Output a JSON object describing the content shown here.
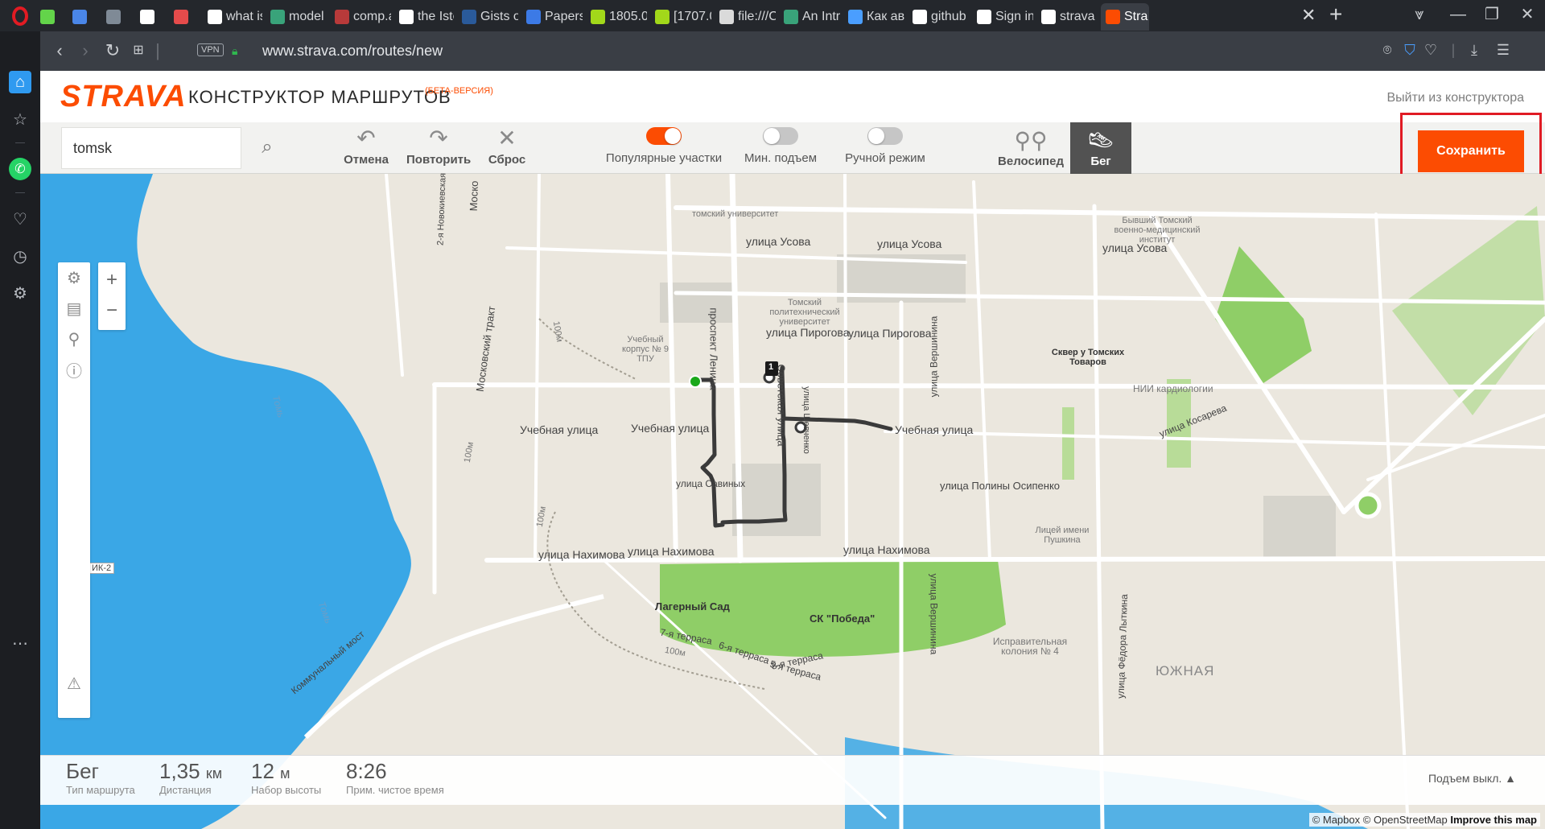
{
  "browser": {
    "tabs": [
      {
        "label": "",
        "color": "#63d44a"
      },
      {
        "label": "",
        "color": "#4a86e8"
      },
      {
        "label": "",
        "color": "#7f8a96"
      },
      {
        "label": "",
        "color": "#ffffff"
      },
      {
        "label": "",
        "color": "#e54b4b"
      },
      {
        "label": "what is",
        "color": "#ffffff"
      },
      {
        "label": "model",
        "color": "#39a37a"
      },
      {
        "label": "comp.a",
        "color": "#b83a3a"
      },
      {
        "label": "the Iste",
        "color": "#ffffff"
      },
      {
        "label": "Gists of",
        "color": "#2a5a9a"
      },
      {
        "label": "Papers",
        "color": "#3c7ae6"
      },
      {
        "label": "1805.0",
        "color": "#a2d81a"
      },
      {
        "label": "[1707.0",
        "color": "#a2d81a"
      },
      {
        "label": "file:///C",
        "color": "#dadada"
      },
      {
        "label": "An Intr",
        "color": "#39a37a"
      },
      {
        "label": "Как ав",
        "color": "#4a9eff"
      },
      {
        "label": "github",
        "color": "#ffffff"
      },
      {
        "label": "Sign in",
        "color": "#ffffff"
      },
      {
        "label": "strava",
        "color": "#ffffff"
      },
      {
        "label": "Stra",
        "color": "#fc4c02"
      }
    ],
    "url": "www.strava.com/routes/new",
    "vpn_label": "VPN"
  },
  "header": {
    "logo": "STRAVA",
    "title": "КОНСТРУКТОР МАРШРУТОВ",
    "beta": "(БЕТА-ВЕРСИЯ)",
    "exit_link": "Выйти из конструктора"
  },
  "toolbar": {
    "search_value": "tomsk",
    "undo": "Отмена",
    "redo": "Повторить",
    "reset": "Сброс",
    "toggles": [
      {
        "label": "Популярные участки",
        "on": true
      },
      {
        "label": "Мин. подъем",
        "on": false
      },
      {
        "label": "Ручной режим",
        "on": false
      }
    ],
    "bike": "Велосипед",
    "run": "Бег",
    "save": "Сохранить"
  },
  "map": {
    "labels": {
      "usova1": "улица Усова",
      "usova2": "улица Усова",
      "usova3": "улица Усова",
      "pirogova1": "улица Пирогова",
      "pirogova2": "улица Пирогова",
      "uchebnaya1": "Учебная улица",
      "uchebnaya2": "Учебная улица",
      "uchebnaya3": "Учебная улица",
      "nakhimova1": "улица Нахимова",
      "nakhimova2": "улица Нахимова",
      "nakhimova3": "улица Нахимова",
      "savinykh": "улица Савиных",
      "osipenko": "улица Полины Осипенко",
      "kosareva": "улица Косарева",
      "lenina": "проспект Ленина",
      "moskovsky": "Московский тракт",
      "sovetskaya": "Советская улица",
      "kirova": "улица Шевченко",
      "vershinina1": "улица Вершинина",
      "vershinina2": "улица Вершинина",
      "lytkina": "улица Фёдора Лыткина",
      "tom1": "Томь",
      "tom2": "Томь",
      "communal": "Коммунальный мост",
      "tpu": "Томский политехнический университет",
      "corp9": "Учебный корпус № 9 ТПУ",
      "square": "Сквер у Томских Товаров",
      "nii": "НИИ кардиологии",
      "lager": "Лагерный Сад",
      "pobeda": "СК \"Победа\"",
      "terrace7": "7-я терраса",
      "terrace6": "6-я терраса",
      "terrace8": "8-я терраса",
      "terrace5": "5-я терраса",
      "lyceum": "Лицей имени Пушкина",
      "colony": "Исправительная колония № 4",
      "institute": "Бывший Томский военно-медицинский институт",
      "univ": "томский университет",
      "yuzhnaya": "ЮЖНАЯ",
      "novo": "2-я Новокиевская",
      "mosk": "Моско",
      "ik2": "ИК-2",
      "m100a": "100м",
      "m100b": "100м",
      "m100c": "100м",
      "m100d": "100м"
    },
    "route_marker": "1",
    "route_color": "#3a3a3a",
    "start_color": "#1aa81a",
    "water_color": "#3aa7e6",
    "park_color": "#8fce67"
  },
  "stats": {
    "type": {
      "value": "Бег",
      "caption": "Тип маршрута"
    },
    "distance": {
      "value": "1,35",
      "unit": "км",
      "caption": "Дистанция"
    },
    "elevation": {
      "value": "12",
      "unit": "м",
      "caption": "Набор высоты"
    },
    "time": {
      "value": "8:26",
      "caption": "Прим. чистое время"
    },
    "elev_toggle": "Подъем выкл. ▲"
  },
  "attribution": {
    "mapbox": "© Mapbox",
    "osm": "© OpenStreetMap",
    "improve": "Improve this map"
  }
}
